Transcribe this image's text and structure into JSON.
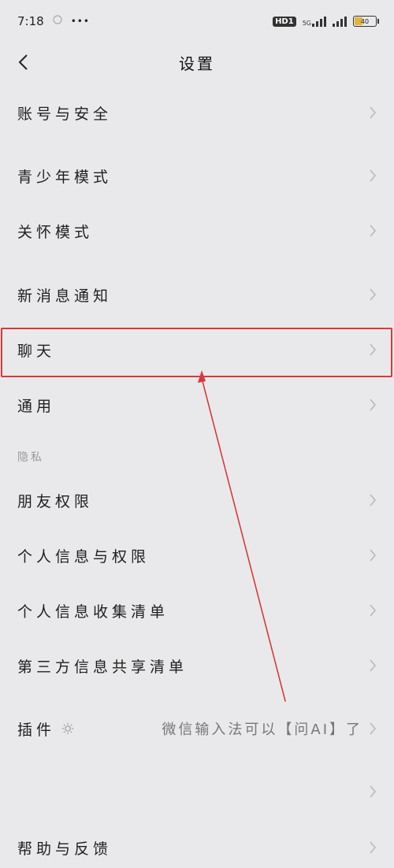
{
  "status_bar": {
    "time": "7:18",
    "more": "•••",
    "hd_badge": "HD1",
    "network_label": "5G",
    "battery_level": "40",
    "battery_fraction": 0.4
  },
  "nav": {
    "title": "设置"
  },
  "settings": {
    "account_security": "账号与安全",
    "teen_mode": "青少年模式",
    "care_mode": "关怀模式",
    "new_message_notify": "新消息通知",
    "chat": "聊天",
    "general": "通用",
    "privacy_section": "隐私",
    "friend_permissions": "朋友权限",
    "personal_info_permissions": "个人信息与权限",
    "personal_info_collection": "个人信息收集清单",
    "third_party_sharing": "第三方信息共享清单",
    "plugins": "插件",
    "plugins_value": "微信输入法可以【问AI】了",
    "help_feedback": "帮助与反馈"
  },
  "colors": {
    "background": "#e9e9eb",
    "highlight": "#d9393a",
    "battery_fill": "#e2b43b"
  },
  "icons": {
    "back": "chevron-left-icon",
    "row_arrow": "chevron-right-icon",
    "plugin": "sun-icon"
  }
}
